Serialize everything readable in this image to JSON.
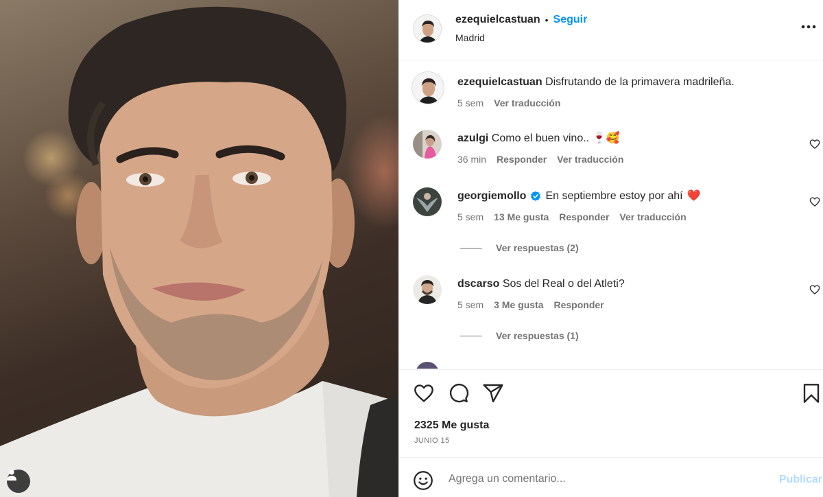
{
  "post": {
    "username": "ezequielcastuan",
    "separator": "•",
    "follow_label": "Seguir",
    "location": "Madrid",
    "more_icon": "more-horizontal-icon"
  },
  "caption": {
    "username": "ezequielcastuan",
    "text": "Disfrutando de la primavera madrileña.",
    "time": "5 sem",
    "translate": "Ver traducción"
  },
  "comments": [
    {
      "username": "azulgi",
      "text": "Como el buen vino.. ",
      "emojis": "🍷🥰",
      "time": "36 min",
      "reply": "Responder",
      "translate": "Ver traducción"
    },
    {
      "username": "georgiemollo",
      "verified": true,
      "text": "En septiembre estoy por ahí",
      "emojis": "❤️",
      "time": "5 sem",
      "likes": "13 Me gusta",
      "reply": "Responder",
      "translate": "Ver traducción",
      "view_replies": "Ver respuestas (2)"
    },
    {
      "username": "dscarso",
      "text": "Sos del Real o del Atleti?",
      "time": "5 sem",
      "likes": "3 Me gusta",
      "reply": "Responder",
      "view_replies": "Ver respuestas (1)"
    }
  ],
  "actions": {
    "likes": "2325 Me gusta",
    "date": "JUNIO 15",
    "icons": [
      "heart-icon",
      "comment-icon",
      "share-icon",
      "bookmark-icon"
    ]
  },
  "add_comment": {
    "placeholder": "Agrega un comentario...",
    "publish_label": "Publicar"
  },
  "colors": {
    "accent": "#0095f6",
    "text": "#262626",
    "secondary": "#737373",
    "border": "#efefef",
    "publish_disabled": "#b3dbff",
    "heart_red": "#ed4956"
  }
}
